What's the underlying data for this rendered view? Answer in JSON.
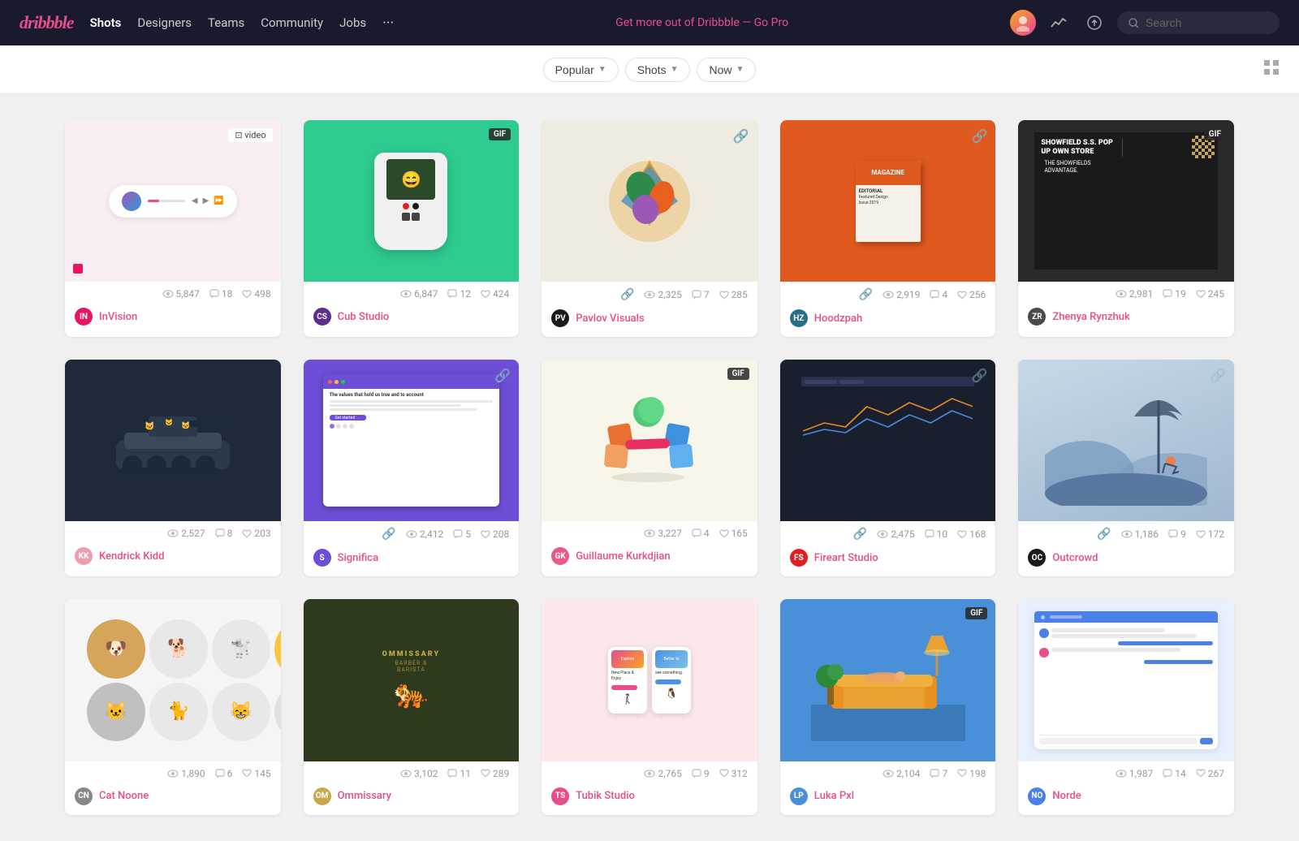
{
  "site": {
    "logo": "dribbble",
    "tagline": "Get more out of Dribbble — Go Pro"
  },
  "navbar": {
    "links": [
      {
        "label": "Shots",
        "active": true
      },
      {
        "label": "Designers",
        "active": false
      },
      {
        "label": "Teams",
        "active": false
      },
      {
        "label": "Community",
        "active": false
      },
      {
        "label": "Jobs",
        "active": false
      }
    ],
    "search_placeholder": "Search",
    "more_label": "···"
  },
  "filters": {
    "popular_label": "Popular",
    "shots_label": "Shots",
    "now_label": "Now"
  },
  "shots": [
    {
      "id": 1,
      "author": "InVision",
      "author_initials": "IN",
      "author_color": "#eb1464",
      "views": "5,847",
      "comments": "18",
      "likes": "498",
      "badge": "video",
      "theme": "invision"
    },
    {
      "id": 2,
      "author": "Cub Studio",
      "author_initials": "CS",
      "author_color": "#5b2d8e",
      "views": "6,847",
      "comments": "12",
      "likes": "424",
      "badge": "GIF",
      "theme": "cub"
    },
    {
      "id": 3,
      "author": "Pavlov Visuals",
      "author_initials": "PV",
      "author_color": "#1a1a1a",
      "views": "2,325",
      "comments": "7",
      "likes": "285",
      "badge": "link",
      "theme": "pavlov"
    },
    {
      "id": 4,
      "author": "Hoodzpah",
      "author_initials": "HZ",
      "author_color": "#2a6e8a",
      "views": "2,919",
      "comments": "4",
      "likes": "256",
      "badge": "link",
      "theme": "hoodzpah"
    },
    {
      "id": 5,
      "author": "Zhenya Rynzhuk",
      "author_initials": "ZR",
      "author_color": "#444",
      "views": "2,981",
      "comments": "19",
      "likes": "245",
      "badge": "GIF",
      "theme": "zhenya"
    },
    {
      "id": 6,
      "author": "Kendrick Kidd",
      "author_initials": "KK",
      "author_color": "#e8a0b0",
      "views": "2,527",
      "comments": "8",
      "likes": "203",
      "badge": null,
      "theme": "kendrick"
    },
    {
      "id": 7,
      "author": "Significa",
      "author_initials": "S",
      "author_color": "#6c4fd6",
      "views": "2,412",
      "comments": "5",
      "likes": "208",
      "badge": "link",
      "theme": "significa"
    },
    {
      "id": 8,
      "author": "Guillaume Kurkdjian",
      "author_initials": "GK",
      "author_color": "#e85a8a",
      "views": "3,227",
      "comments": "4",
      "likes": "165",
      "badge": "GIF",
      "theme": "guillaume"
    },
    {
      "id": 9,
      "author": "Fireart Studio",
      "author_initials": "FS",
      "author_color": "#e02020",
      "views": "2,475",
      "comments": "10",
      "likes": "168",
      "badge": "link",
      "theme": "fireart"
    },
    {
      "id": 10,
      "author": "Outcrowd",
      "author_initials": "OC",
      "author_color": "#1a1a1a",
      "views": "1,186",
      "comments": "9",
      "likes": "172",
      "badge": "link",
      "theme": "outcrowd"
    },
    {
      "id": 11,
      "author": "Cat Noone",
      "author_initials": "CN",
      "author_color": "#888",
      "views": "1,890",
      "comments": "6",
      "likes": "145",
      "badge": null,
      "theme": "pets"
    },
    {
      "id": 12,
      "author": "Ommissary",
      "author_initials": "OM",
      "author_color": "#c8a84a",
      "views": "3,102",
      "comments": "11",
      "likes": "289",
      "badge": null,
      "theme": "ommissary"
    },
    {
      "id": 13,
      "author": "Tubik Studio",
      "author_initials": "TS",
      "author_color": "#ea4c89",
      "views": "2,765",
      "comments": "9",
      "likes": "312",
      "badge": null,
      "theme": "explore"
    },
    {
      "id": 14,
      "author": "Luka Pxl",
      "author_initials": "LP",
      "author_color": "#4a90d9",
      "views": "2,104",
      "comments": "7",
      "likes": "198",
      "badge": "GIF",
      "theme": "couch"
    },
    {
      "id": 15,
      "author": "Norde",
      "author_initials": "NO",
      "author_color": "#4a80e8",
      "views": "1,987",
      "comments": "14",
      "likes": "267",
      "badge": null,
      "theme": "message"
    }
  ]
}
